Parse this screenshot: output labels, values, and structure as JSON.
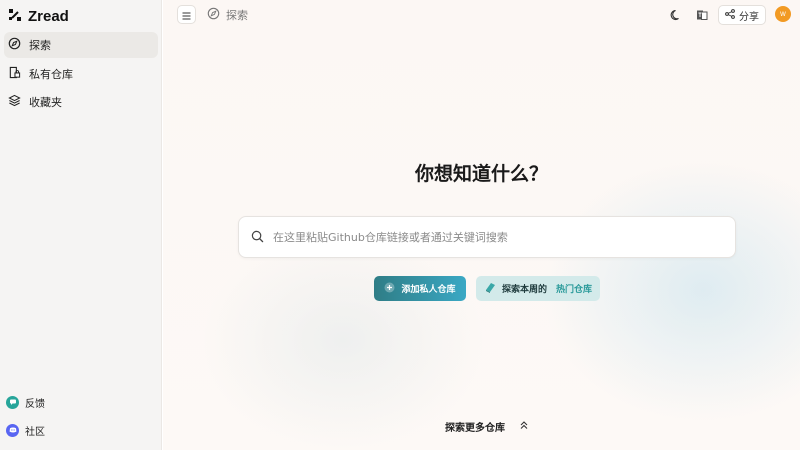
{
  "app": {
    "name": "Zread"
  },
  "sidebar": {
    "items": [
      {
        "label": "探索",
        "icon": "compass-icon",
        "active": true
      },
      {
        "label": "私有仓库",
        "icon": "repo-lock-icon",
        "active": false
      },
      {
        "label": "收藏夹",
        "icon": "layers-icon",
        "active": false
      }
    ],
    "bottom": [
      {
        "label": "反馈",
        "icon": "feedback-icon",
        "color": "#27a59a"
      },
      {
        "label": "社区",
        "icon": "discord-icon",
        "color": "#5865f2"
      }
    ]
  },
  "topbar": {
    "breadcrumb": "探索",
    "share_label": "分享",
    "avatar_text": "W"
  },
  "hero": {
    "title": "你想知道什么？",
    "search_placeholder": "在这里粘贴Github仓库链接或者通过关键词搜索",
    "add_private_label": "添加私人仓库",
    "explore_week_label": "探索本周的",
    "hot_repo_label": "热门仓库",
    "explore_more_label": "探索更多仓库"
  },
  "colors": {
    "accent": "#2f8f9a",
    "avatar": "#f29a23"
  }
}
